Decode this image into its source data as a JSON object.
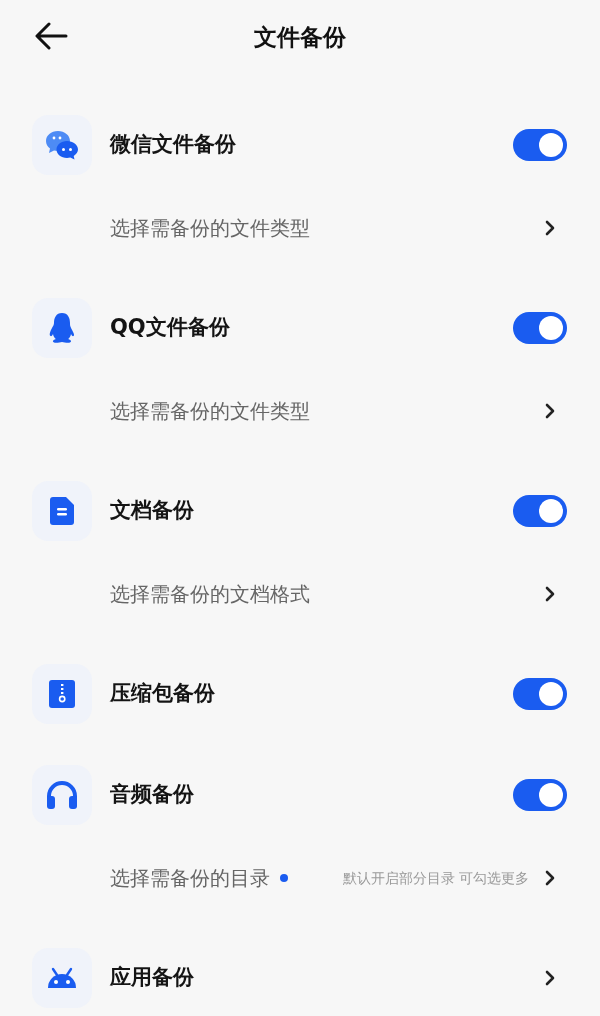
{
  "header": {
    "title": "文件备份"
  },
  "items": [
    {
      "kind": "toggle",
      "label": "微信文件备份",
      "on": true
    },
    {
      "kind": "link",
      "label": "选择需备份的文件类型"
    },
    {
      "kind": "toggle",
      "label": "QQ文件备份",
      "on": true
    },
    {
      "kind": "link",
      "label": "选择需备份的文件类型"
    },
    {
      "kind": "toggle",
      "label": "文档备份",
      "on": true
    },
    {
      "kind": "link",
      "label": "选择需备份的文档格式"
    },
    {
      "kind": "toggle",
      "label": "压缩包备份",
      "on": true
    },
    {
      "kind": "toggle",
      "label": "音频备份",
      "on": true
    },
    {
      "kind": "link",
      "label": "选择需备份的目录",
      "dot": true,
      "hint": "默认开启部分目录 可勾选更多"
    },
    {
      "kind": "nav",
      "label": "应用备份"
    }
  ]
}
